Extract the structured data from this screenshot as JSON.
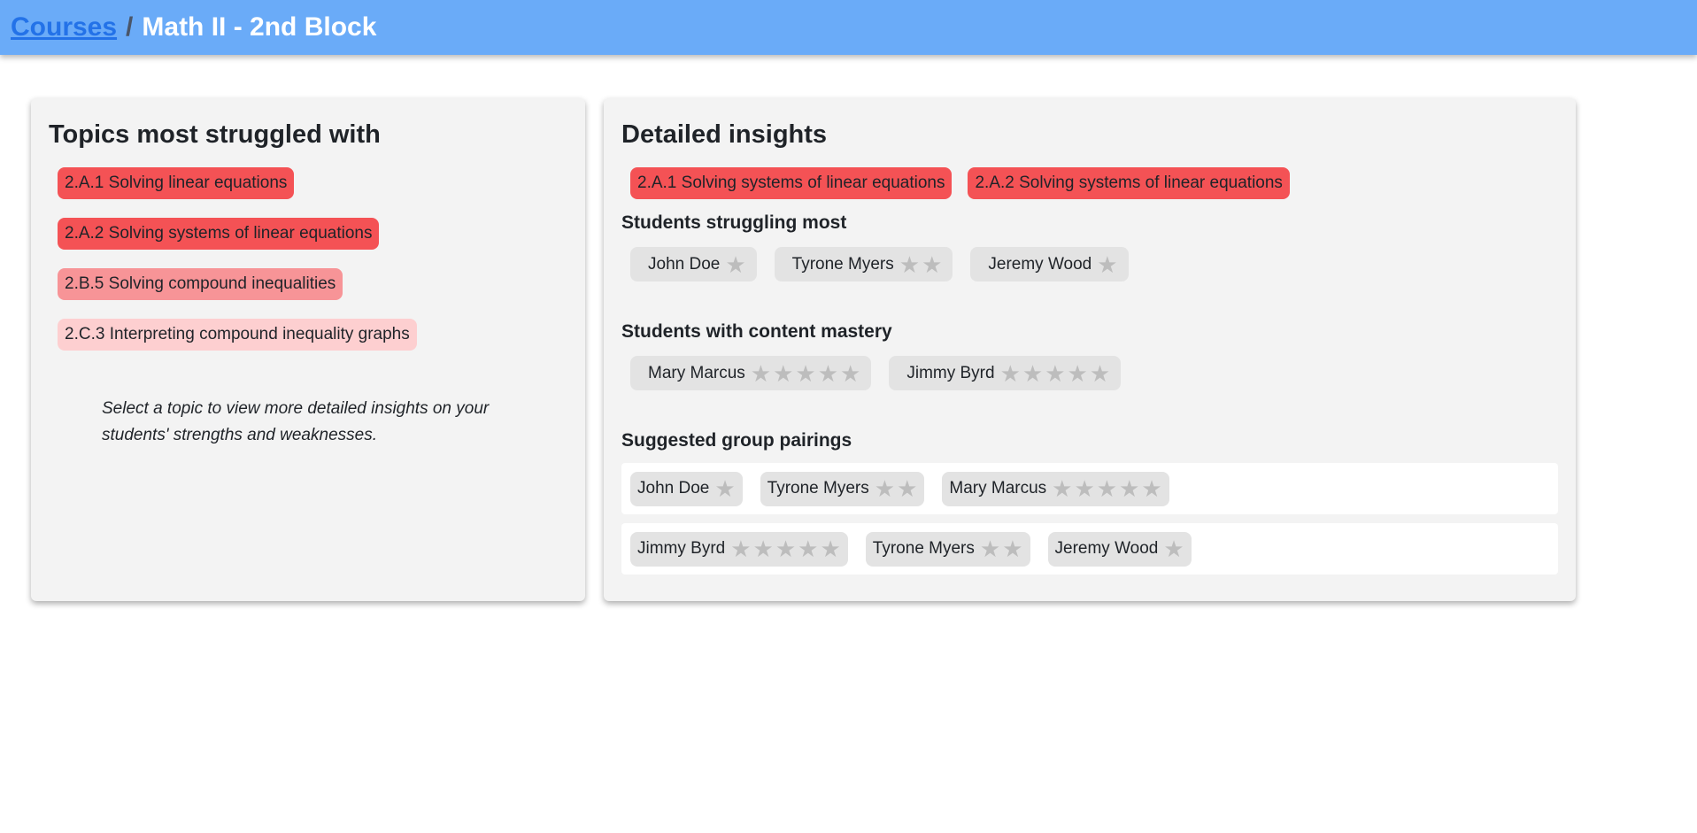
{
  "header": {
    "courses_link": "Courses",
    "separator": "/",
    "current": "Math II - 2nd Block"
  },
  "left": {
    "title": "Topics most struggled with",
    "topics": [
      {
        "label": "2.A.1 Solving linear equations",
        "severity": "high",
        "color": "#f45255"
      },
      {
        "label": "2.A.2 Solving systems of linear equations",
        "severity": "high",
        "color": "#f45255"
      },
      {
        "label": "2.B.5 Solving compound inequalities",
        "severity": "medium",
        "color": "#f79497"
      },
      {
        "label": "2.C.3 Interpreting compound inequality graphs",
        "severity": "low",
        "color": "#fdcfd0"
      }
    ],
    "hint": "Select a topic to view more detailed insights on your students' strengths and weaknesses."
  },
  "right": {
    "title": "Detailed insights",
    "selected_topics": [
      "2.A.1 Solving systems of linear equations",
      "2.A.2 Solving systems of linear equations"
    ],
    "struggling_title": "Students struggling most",
    "struggling": [
      {
        "name": "John Doe",
        "stars": 1
      },
      {
        "name": "Tyrone Myers",
        "stars": 2
      },
      {
        "name": "Jeremy Wood",
        "stars": 1
      }
    ],
    "mastery_title": "Students with content mastery",
    "mastery": [
      {
        "name": "Mary Marcus",
        "stars": 5
      },
      {
        "name": "Jimmy Byrd",
        "stars": 5
      }
    ],
    "pairings_title": "Suggested group pairings",
    "pairings": [
      [
        {
          "name": "John Doe",
          "stars": 1
        },
        {
          "name": "Tyrone Myers",
          "stars": 2
        },
        {
          "name": "Mary Marcus",
          "stars": 5
        }
      ],
      [
        {
          "name": "Jimmy Byrd",
          "stars": 5
        },
        {
          "name": "Tyrone Myers",
          "stars": 2
        },
        {
          "name": "Jeremy Wood",
          "stars": 1
        }
      ]
    ]
  },
  "colors": {
    "header_bg": "#6aabf8",
    "link": "#2372e8",
    "chip_high": "#f45255",
    "chip_medium": "#f79497",
    "chip_low": "#fdcfd0",
    "student_chip_bg": "#e3e3e3",
    "star": "#bdbdbd"
  },
  "icons": {
    "star": "star-icon"
  }
}
